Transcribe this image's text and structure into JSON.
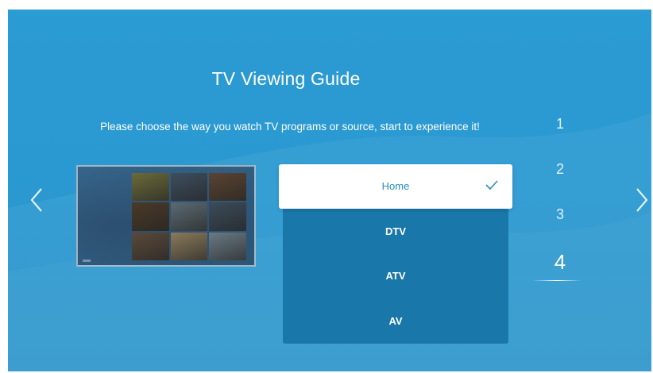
{
  "guide": {
    "title": "TV Viewing Guide",
    "subtitle": "Please choose the way you watch TV programs or source, start to experience it!"
  },
  "navigation": {
    "prev_icon": "chevron-left-icon",
    "next_icon": "chevron-right-icon"
  },
  "sources": {
    "items": [
      {
        "label": "Home",
        "selected": true
      },
      {
        "label": "DTV",
        "selected": false
      },
      {
        "label": "ATV",
        "selected": false
      },
      {
        "label": "AV",
        "selected": false
      }
    ],
    "selected_icon": "checkmark-icon"
  },
  "steps": {
    "items": [
      "1",
      "2",
      "3",
      "4"
    ],
    "active": "4"
  },
  "preview": {
    "content": "movie-poster-grid",
    "poster_colors": [
      "#6b6a3a",
      "#3e4e5e",
      "#5a4432",
      "#4a3a28",
      "#5c6a72",
      "#3c4c5a",
      "#5a4a3a",
      "#8a7a5a",
      "#6a7a84"
    ]
  },
  "colors": {
    "background": "#2b9bd3",
    "list_background": "#1a77a9",
    "selected_background": "#ffffff",
    "selected_text": "#2a8cc6",
    "text": "#ffffff"
  }
}
